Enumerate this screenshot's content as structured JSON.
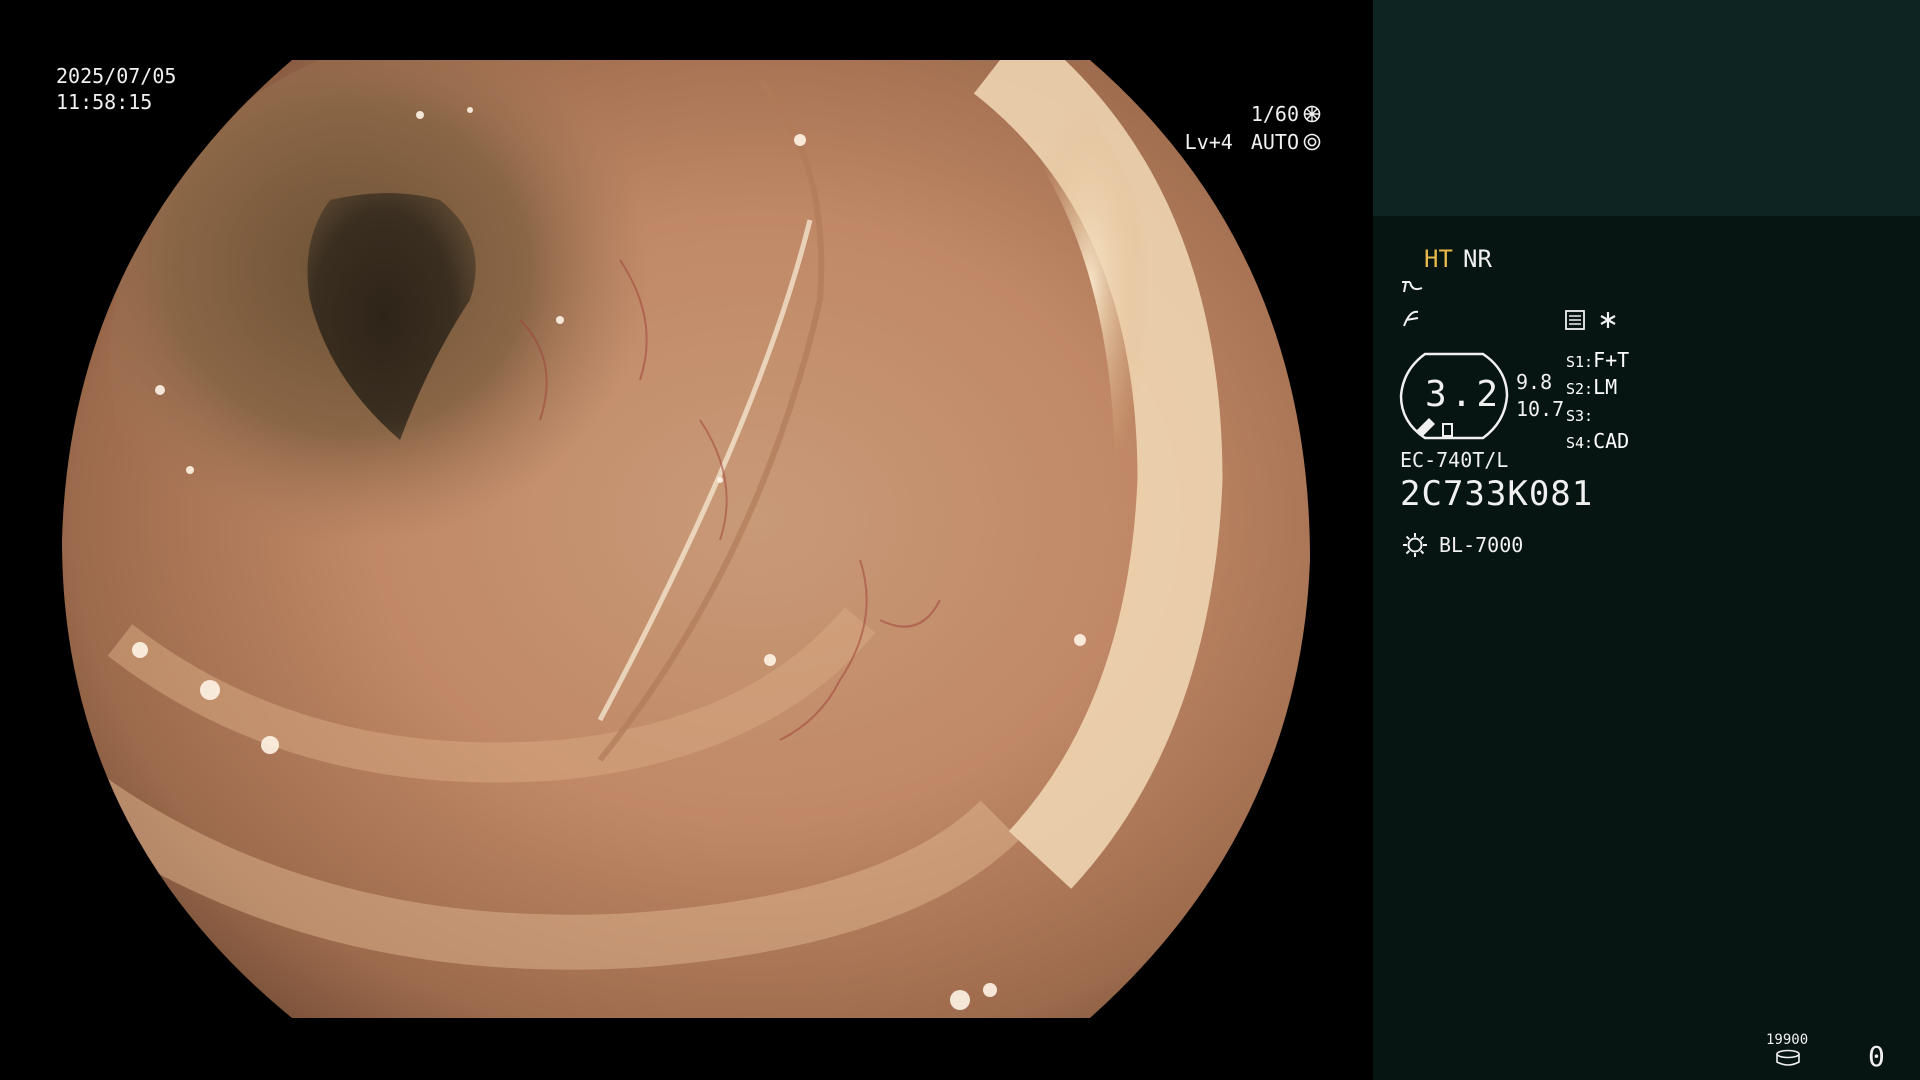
{
  "video": {
    "date": "2025/07/05",
    "time": "11:58:15",
    "shutter": "1/60",
    "level": "Lv+4",
    "iris": "AUTO"
  },
  "panel": {
    "ht": "HT",
    "nr": "NR",
    "zoom_value": "3.2",
    "zoom_min": "9.8",
    "zoom_max": "10.7",
    "switches": [
      {
        "key": "S1:",
        "value": "F+T"
      },
      {
        "key": "S2:",
        "value": "LM"
      },
      {
        "key": "S3:",
        "value": ""
      },
      {
        "key": "S4:",
        "value": "CAD"
      }
    ],
    "scope_model": "EC-740T/L",
    "serial": "2C733K081",
    "light_source": "BL-7000",
    "counter_label": "19900",
    "counter_value": "0"
  },
  "icons": [
    "shutter-icon",
    "iris-icon",
    "enhance-curve-icon",
    "gamma-icon",
    "menu-icon",
    "asterisk-icon",
    "light-source-icon",
    "storage-icon"
  ],
  "colors": {
    "panel_bg": "#061412",
    "panel_top": "#0e2422",
    "ht_accent": "#e8b84a"
  }
}
